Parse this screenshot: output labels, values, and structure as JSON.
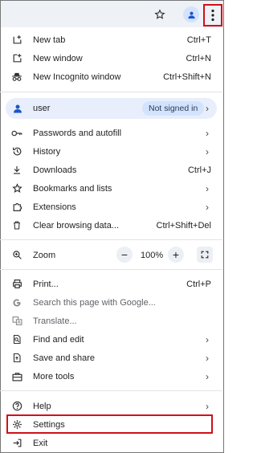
{
  "menu": {
    "new_tab": {
      "label": "New tab",
      "shortcut": "Ctrl+T",
      "icon": "new-tab-icon"
    },
    "new_window": {
      "label": "New window",
      "shortcut": "Ctrl+N",
      "icon": "new-window-icon"
    },
    "new_incognito": {
      "label": "New Incognito window",
      "shortcut": "Ctrl+Shift+N",
      "icon": "incognito-icon"
    },
    "profile": {
      "name": "user",
      "status": "Not signed in",
      "icon": "person-icon"
    },
    "passwords": {
      "label": "Passwords and autofill",
      "icon": "key-icon"
    },
    "history": {
      "label": "History",
      "icon": "history-icon"
    },
    "downloads": {
      "label": "Downloads",
      "shortcut": "Ctrl+J",
      "icon": "download-icon"
    },
    "bookmarks": {
      "label": "Bookmarks and lists",
      "icon": "star-icon"
    },
    "extensions": {
      "label": "Extensions",
      "icon": "puzzle-icon"
    },
    "clear_data": {
      "label": "Clear browsing data...",
      "shortcut": "Ctrl+Shift+Del",
      "icon": "trash-icon"
    },
    "zoom": {
      "label": "Zoom",
      "value": "100%",
      "icon": "zoom-icon"
    },
    "print": {
      "label": "Print...",
      "shortcut": "Ctrl+P",
      "icon": "print-icon"
    },
    "search_page": {
      "label": "Search this page with Google...",
      "icon": "google-icon"
    },
    "translate": {
      "label": "Translate...",
      "icon": "translate-icon"
    },
    "find_edit": {
      "label": "Find and edit",
      "icon": "find-icon"
    },
    "save_share": {
      "label": "Save and share",
      "icon": "save-share-icon"
    },
    "more_tools": {
      "label": "More tools",
      "icon": "toolbox-icon"
    },
    "help": {
      "label": "Help",
      "icon": "help-icon"
    },
    "settings": {
      "label": "Settings",
      "icon": "gear-icon"
    },
    "exit": {
      "label": "Exit",
      "icon": "exit-icon"
    }
  },
  "highlight_color": "#d0101a",
  "accent_color": "#1a56c8"
}
